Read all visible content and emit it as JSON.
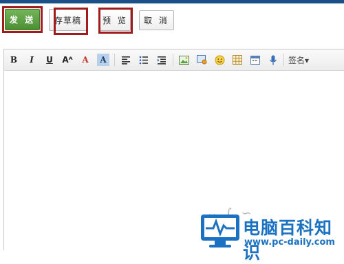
{
  "actions": {
    "send_label": "发 送",
    "draft_label": "存草稿",
    "preview_label": "预 览",
    "cancel_label": "取 消"
  },
  "toolbar": {
    "bold": "B",
    "italic": "I",
    "underline": "U",
    "font_size": "Aᴬ",
    "font_color": "A",
    "bg_color": "A",
    "signature_label": "签名▾"
  },
  "watermark": {
    "brand": "电脑百科知识",
    "url": "www.pc-daily.com"
  },
  "colors": {
    "accent_top": "#1c4f87",
    "send_button": "#5aa13e",
    "highlight": "#a01c1c",
    "brand_blue": "#1b72c2"
  }
}
